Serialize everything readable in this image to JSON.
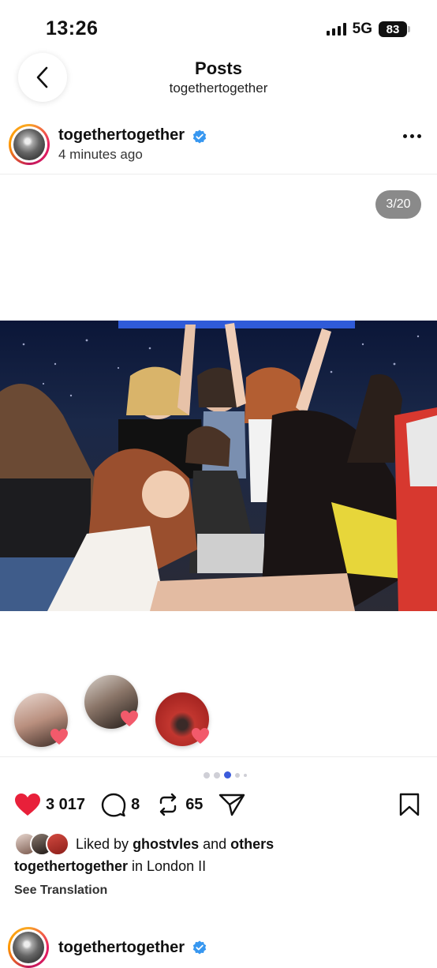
{
  "status_bar": {
    "time": "13:26",
    "network": "5G",
    "battery": "83"
  },
  "header": {
    "title": "Posts",
    "subtitle": "togethertogether"
  },
  "post": {
    "username": "togethertogether",
    "timestamp": "4 minutes ago",
    "image_counter": "3/20",
    "carousel": {
      "total_dots": 5,
      "active_index": 2
    },
    "likers": [
      {
        "name": "liker-1",
        "color": "#d9b8a8"
      },
      {
        "name": "liker-2",
        "color": "#7a6a60"
      },
      {
        "name": "liker-3",
        "color": "#c62828"
      }
    ],
    "actions": {
      "likes": "3 017",
      "comments": "8",
      "reposts": "65"
    },
    "liked_by": {
      "prefix": "Liked by",
      "user": "ghostvles",
      "joiner": "and",
      "suffix": "others"
    },
    "caption": {
      "user": "togethertogether",
      "text": "in London II"
    },
    "see_translation": "See Translation"
  },
  "next_post": {
    "username": "togethertogether"
  },
  "colors": {
    "like_red": "#e8203a",
    "verified_blue": "#3797f0",
    "active_dot": "#3b5bdb"
  }
}
